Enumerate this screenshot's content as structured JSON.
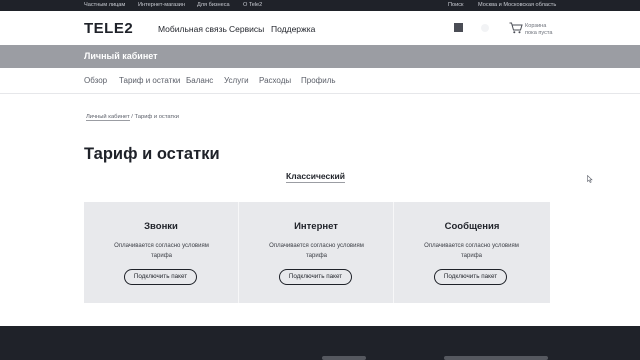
{
  "topbar": {
    "links": [
      "Частным лицам",
      "Интернет-магазин",
      "Для бизнеса",
      "О Tele2"
    ],
    "search": "Поиск",
    "region": "Москва и Московская область"
  },
  "header": {
    "logo": "TELE2",
    "nav": [
      "Мобильная связь",
      "Сервисы",
      "Поддержка"
    ],
    "cart_line1": "Корзина",
    "cart_line2": "пока пуста"
  },
  "band": {
    "title": "Личный кабинет"
  },
  "subnav": {
    "items": [
      "Обзор",
      "Тариф и остатки",
      "Баланс",
      "Услуги",
      "Расходы",
      "Профиль"
    ]
  },
  "breadcrumb": {
    "link": "Личный кабинет",
    "separator": "/",
    "current": "Тариф и остатки"
  },
  "page": {
    "title": "Тариф и остатки",
    "tariff": "Классический"
  },
  "cards": [
    {
      "title": "Звонки",
      "desc": "Оплачивается согласно условиям тарифа",
      "button": "Подключить пакет"
    },
    {
      "title": "Интернет",
      "desc": "Оплачивается согласно условиям тарифа",
      "button": "Подключить пакет"
    },
    {
      "title": "Сообщения",
      "desc": "Оплачивается согласно условиям тарифа",
      "button": "Подключить пакет"
    }
  ],
  "colors": {
    "dark": "#1f2229",
    "band": "#9b9da3",
    "card_bg": "#e8e9ec"
  }
}
